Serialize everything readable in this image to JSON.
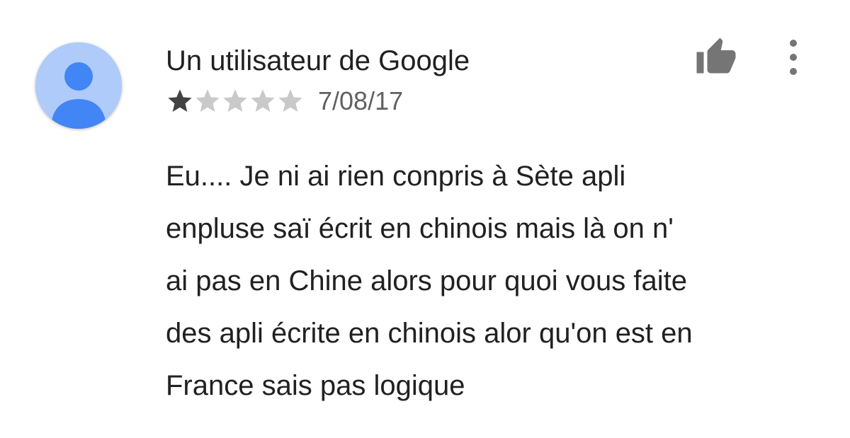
{
  "review": {
    "reviewer_name": "Un utilisateur de Google",
    "rating": 1,
    "max_rating": 5,
    "date": "7/08/17",
    "text_lines": [
      "Eu.... Je ni ai rien conpris à Sète apli",
      "enpluse saï écrit en chinois mais là on n'",
      "ai pas en Chine alors pour quoi vous faite",
      "des apli écrite en chinois alor qu'on est en",
      "France sais pas logique"
    ]
  },
  "icons": {
    "avatar": "default-user-avatar-icon",
    "helpful": "thumbs-up-icon",
    "menu": "more-vert-icon",
    "star": "star-icon"
  },
  "colors": {
    "avatar_bg": "#aecbfa",
    "avatar_figure": "#4285f4",
    "star_filled": "#424242",
    "star_empty": "#c9c9c9",
    "icon_gray": "#757575"
  }
}
